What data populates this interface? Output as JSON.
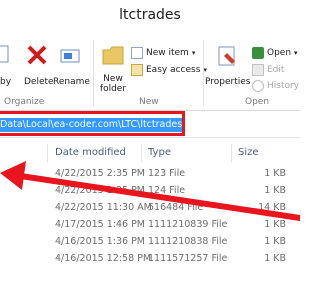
{
  "window": {
    "title": "ltctrades"
  },
  "ribbon": {
    "copy_label": "by",
    "delete_label": "Delete",
    "rename_label": "Rename",
    "new_folder_label": "New\nfolder",
    "new_item_label": "New item",
    "easy_access_label": "Easy access",
    "properties_label": "Properties",
    "open_label": "Open",
    "edit_label": "Edit",
    "history_label": "History",
    "groups": {
      "organize": "Organize",
      "new": "New",
      "open": "Open"
    }
  },
  "address": {
    "path": "Data\\Local\\ea-coder.com\\LTC\\ltctrades"
  },
  "columns": {
    "date_modified": "Date modified",
    "type": "Type",
    "size": "Size"
  },
  "files": [
    {
      "date": "4/22/2015 2:35 PM",
      "type": "123 File",
      "size": "1 KB"
    },
    {
      "date": "4/22/2015 2:35 PM",
      "type": "124 File",
      "size": "1 KB"
    },
    {
      "date": "4/22/2015 11:30 AM",
      "type": "516484 File",
      "size": "14 KB"
    },
    {
      "date": "4/17/2015 1:46 PM",
      "type": "1111210839 File",
      "size": "1 KB"
    },
    {
      "date": "4/16/2015 1:36 PM",
      "type": "1111210838 File",
      "size": "1 KB"
    },
    {
      "date": "4/16/2015 12:58 PM",
      "type": "1111571257 File",
      "size": "1 KB"
    }
  ],
  "colors": {
    "annotation": "#e8141e",
    "selection": "#3399ff",
    "header_text": "#4c607a"
  }
}
